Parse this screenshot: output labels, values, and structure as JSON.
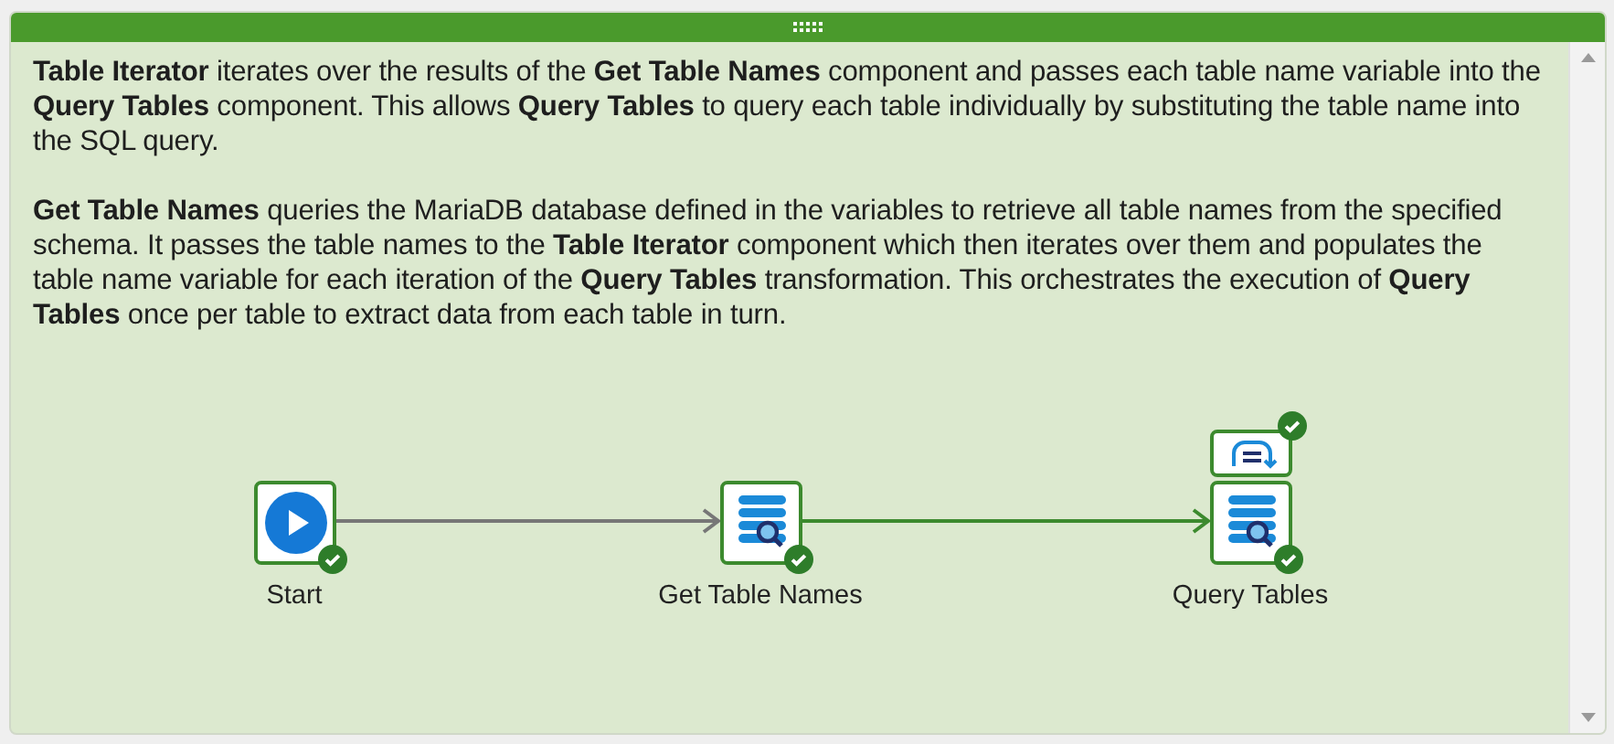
{
  "note": {
    "paragraphs": [
      "**Table Iterator** iterates over the results of the **Get Table Names** component and passes each table name variable into the **Query Tables** component. This allows **Query Tables** to query each table individually by substituting the table name into the SQL query.",
      "**Get Table Names** queries the MariaDB database defined in the variables to retrieve all table names from the specified schema. It passes the table names to the **Table Iterator** component which then iterates over them and populates the table name variable for each iteration of the **Query Tables** transformation. This orchestrates the execution of **Query Tables** once per table to extract data from each table in turn."
    ]
  },
  "pipeline": {
    "nodes": [
      {
        "label": "Start",
        "kind": "start",
        "succeeded": true
      },
      {
        "label": "Get Table Names",
        "kind": "query",
        "succeeded": true
      },
      {
        "label": "Query Tables",
        "kind": "query",
        "succeeded": true,
        "iterator": {
          "succeeded": true
        }
      }
    ],
    "connectors": [
      {
        "kind": "unconditional"
      },
      {
        "kind": "success"
      }
    ]
  }
}
